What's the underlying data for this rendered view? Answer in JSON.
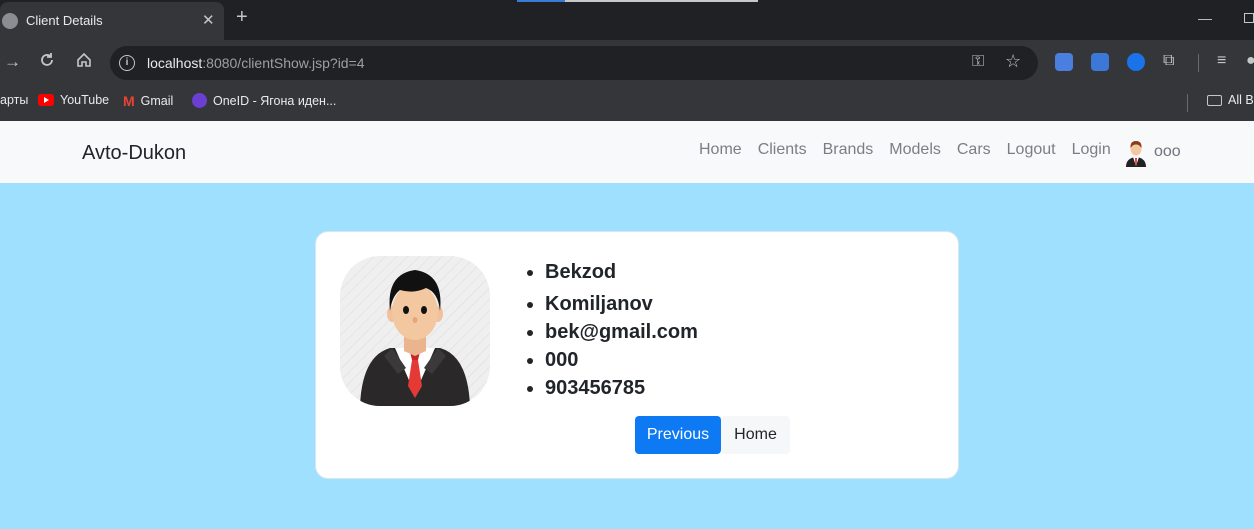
{
  "browser": {
    "tab_title": "Client Details",
    "url_host": "localhost",
    "url_path": ":8080/clientShow.jsp?id=4",
    "bookmarks": [
      {
        "label": "арты",
        "icon": "none"
      },
      {
        "label": "YouTube",
        "icon": "youtube-icon"
      },
      {
        "label": "Gmail",
        "icon": "gmail-icon"
      },
      {
        "label": "OneID - Ягона иден...",
        "icon": "oneid-icon"
      }
    ],
    "all_bookmarks_label": "All B"
  },
  "navbar": {
    "brand": "Avto-Dukon",
    "links": [
      "Home",
      "Clients",
      "Brands",
      "Models",
      "Cars",
      "Logout",
      "Login"
    ],
    "username": "ooo"
  },
  "client": {
    "first_name": "Bekzod",
    "last_name": "Komiljanov",
    "email": "bek@gmail.com",
    "code": "000",
    "phone": "903456785"
  },
  "buttons": {
    "previous": "Previous",
    "home": "Home"
  },
  "colors": {
    "page_bg": "#9ee0fd",
    "primary": "#0d79f3",
    "navbar_bg": "#f8f9fa"
  }
}
